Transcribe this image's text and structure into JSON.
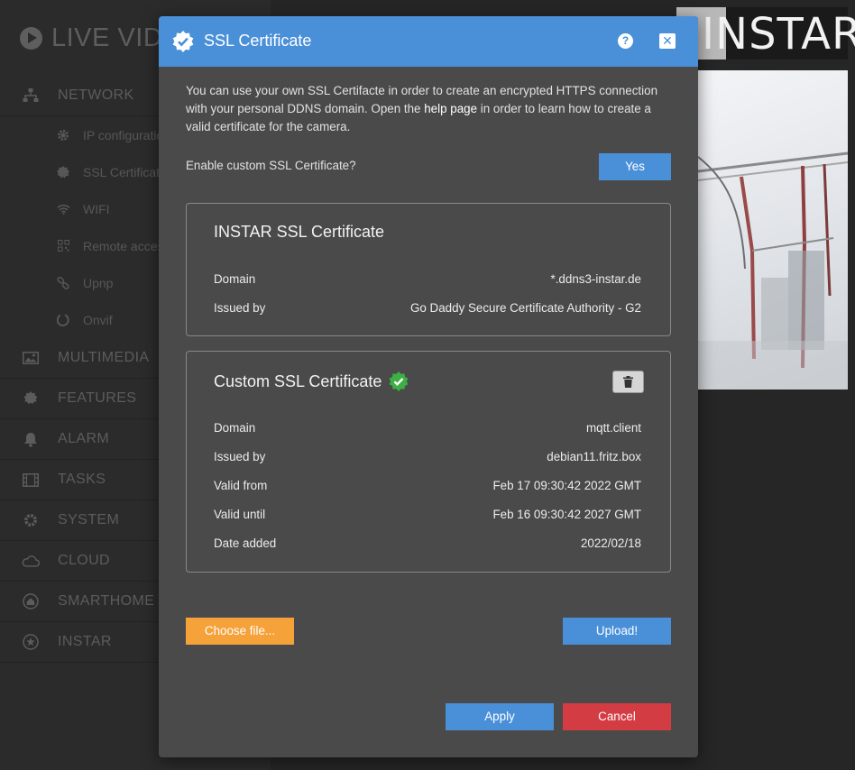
{
  "sidebar": {
    "brand": "LIVE VIDEO",
    "network": {
      "label": "NETWORK",
      "icon": "sitemap-icon"
    },
    "sub_items": [
      {
        "label": "IP configuration",
        "icon": "gear-icon"
      },
      {
        "label": "SSL Certificate",
        "icon": "badge-icon"
      },
      {
        "label": "WIFI",
        "icon": "wifi-icon"
      },
      {
        "label": "Remote access",
        "icon": "qrcode-icon"
      },
      {
        "label": "Upnp",
        "icon": "link-icon"
      },
      {
        "label": "Onvif",
        "icon": "circle-notch-icon"
      }
    ],
    "items": [
      {
        "label": "MULTIMEDIA",
        "icon": "image-icon"
      },
      {
        "label": "FEATURES",
        "icon": "gear-icon"
      },
      {
        "label": "ALARM",
        "icon": "bell-icon"
      },
      {
        "label": "TASKS",
        "icon": "film-icon"
      },
      {
        "label": "SYSTEM",
        "icon": "cog-icon"
      },
      {
        "label": "CLOUD",
        "icon": "cloud-icon"
      },
      {
        "label": "SMARTHOME",
        "icon": "home-icon"
      },
      {
        "label": "INSTAR",
        "icon": "star-icon"
      }
    ]
  },
  "logo": {
    "text": "INSTAR"
  },
  "modal": {
    "title": "SSL Certificate",
    "help_label": "?",
    "close_label": "✕",
    "intro_before": "You can use your own SSL Certifacte in order to create an encrypted HTTPS connection with your personal DDNS domain. Open the ",
    "intro_link": "help page",
    "intro_after": " in order to learn how to create a valid certificate for the camera.",
    "enable_label": "Enable custom SSL Certificate?",
    "enable_value": "Yes",
    "instar_card": {
      "title": "INSTAR SSL Certificate",
      "rows": [
        {
          "label": "Domain",
          "value": "*.ddns3-instar.de"
        },
        {
          "label": "Issued by",
          "value": "Go Daddy Secure Certificate Authority - G2"
        }
      ]
    },
    "custom_card": {
      "title": "Custom SSL Certificate",
      "rows": [
        {
          "label": "Domain",
          "value": "mqtt.client"
        },
        {
          "label": "Issued by",
          "value": "debian11.fritz.box"
        },
        {
          "label": "Valid from",
          "value": "Feb 17 09:30:42 2022 GMT"
        },
        {
          "label": "Valid until",
          "value": "Feb 16 09:30:42 2027 GMT"
        },
        {
          "label": "Date added",
          "value": "2022/02/18"
        }
      ]
    },
    "choose_file_label": "Choose file...",
    "upload_label": "Upload!",
    "apply_label": "Apply",
    "cancel_label": "Cancel"
  },
  "colors": {
    "accent_blue": "#4a90d9",
    "orange": "#f5a23a",
    "danger": "#d43c44",
    "verified_green": "#3cb043"
  }
}
